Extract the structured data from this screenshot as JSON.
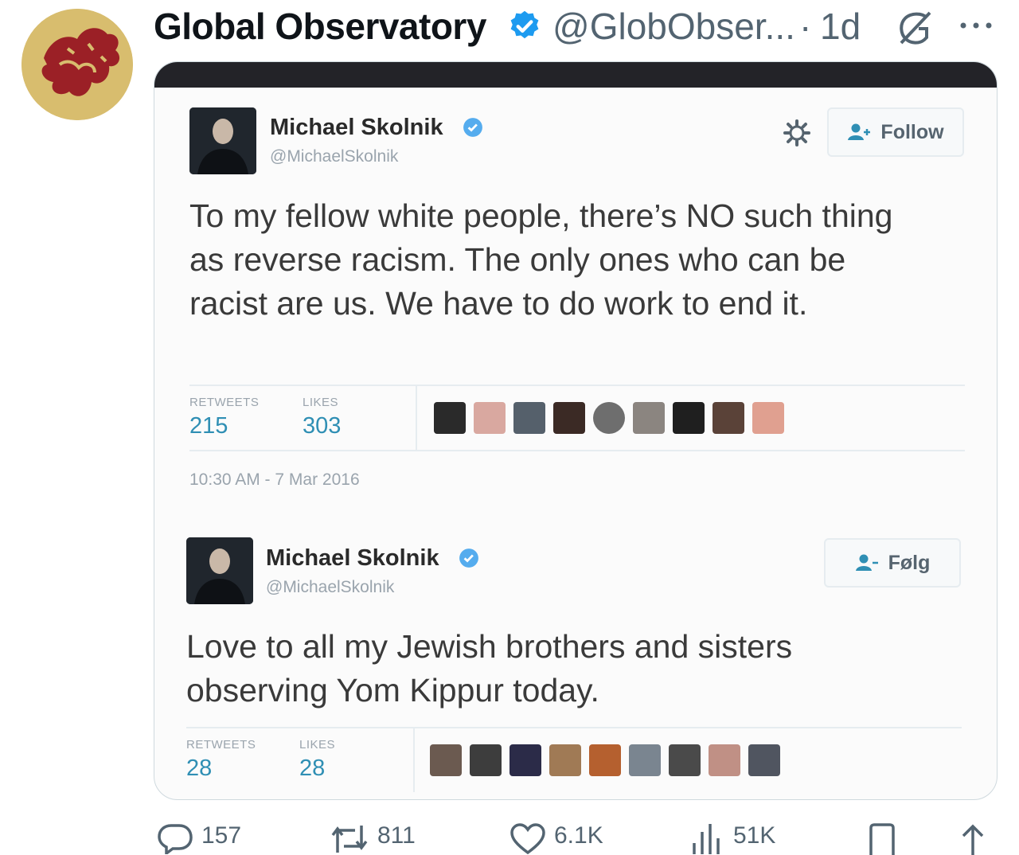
{
  "post": {
    "author_name": "Global Observatory",
    "author_handle": "@GlobObser...",
    "separator": "·",
    "time": "1d"
  },
  "embedded_image": {
    "tweet1": {
      "name": "Michael Skolnik",
      "handle": "@MichaelSkolnik",
      "follow_label": "Follow",
      "text": "To my fellow white people, there’s NO such thing as reverse racism. The only ones who can be racist are us. We have to do work to end it.",
      "retweets_label": "RETWEETS",
      "retweets": "215",
      "likes_label": "LIKES",
      "likes": "303",
      "timestamp": "10:30 AM - 7 Mar 2016"
    },
    "tweet2": {
      "name": "Michael Skolnik",
      "handle": "@MichaelSkolnik",
      "follow_label": "Følg",
      "text": "Love to all my Jewish brothers and sisters observing Yom Kippur today.",
      "retweets_label": "RETWEETS",
      "retweets": "28",
      "likes_label": "LIKES",
      "likes": "28"
    }
  },
  "actions": {
    "reply_count": "157",
    "repost_count": "811",
    "like_count": "6.1K",
    "views_count": "51K"
  },
  "colors": {
    "verified_blue": "#1d9bf0",
    "secondary_text": "#536471",
    "stat_blue": "#2f8fb4"
  },
  "icons": [
    "verified-icon",
    "grok-icon",
    "more-icon",
    "gear-icon",
    "follow-user-icon",
    "reply-icon",
    "repost-icon",
    "like-icon",
    "views-icon",
    "bookmark-icon",
    "share-icon"
  ]
}
